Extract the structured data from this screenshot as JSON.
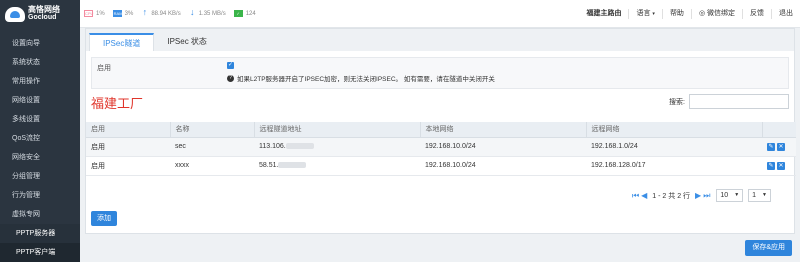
{
  "brand": {
    "name_cn": "高恪网络",
    "name_en": "Gocloud"
  },
  "sidebar": {
    "items": [
      {
        "label": "设置向导"
      },
      {
        "label": "系统状态"
      },
      {
        "label": "常用操作"
      },
      {
        "label": "网络设置"
      },
      {
        "label": "多线设置"
      },
      {
        "label": "QoS流控"
      },
      {
        "label": "网络安全"
      },
      {
        "label": "分组管理"
      },
      {
        "label": "行为管理"
      },
      {
        "label": "虚拟专网"
      }
    ],
    "sub_items": [
      {
        "label": "PPTP服务器"
      },
      {
        "label": "PPTP客户端"
      }
    ]
  },
  "status": {
    "cpu": "1%",
    "mem": "3%",
    "upload": "88.94 KB/s",
    "download": "1.35 MB/s",
    "connections": "124"
  },
  "topbar": {
    "router_name": "福建主路由",
    "language": "语言",
    "help": "帮助",
    "wechat": "微信绑定",
    "feedback": "反馈",
    "logout": "退出"
  },
  "tabs": [
    {
      "label": "IPSec隧道"
    },
    {
      "label": "IPSec 状态"
    }
  ],
  "enable": {
    "label": "启用",
    "hint": "如果L2TP服务器开启了IPSEC加密，则无法关闭IPSEC。 如有需要，请在隧道中关闭开关"
  },
  "site_title": "福建工厂",
  "search": {
    "label": "搜索:",
    "placeholder": ""
  },
  "table": {
    "headers": [
      "启用",
      "名称",
      "远程隧道地址",
      "本地网络",
      "远程网络",
      ""
    ],
    "rows": [
      {
        "enabled": "启用",
        "name": "sec",
        "remote": "113.106.",
        "local": "192.168.10.0/24",
        "remote_net": "192.168.1.0/24"
      },
      {
        "enabled": "启用",
        "name": "xxxx",
        "remote": "58.51.",
        "local": "192.168.10.0/24",
        "remote_net": "192.168.128.0/17"
      }
    ]
  },
  "pager": {
    "info": "1 - 2 共 2 行",
    "page_size": "10",
    "page": "1"
  },
  "buttons": {
    "add": "添加",
    "save": "保存&应用"
  }
}
